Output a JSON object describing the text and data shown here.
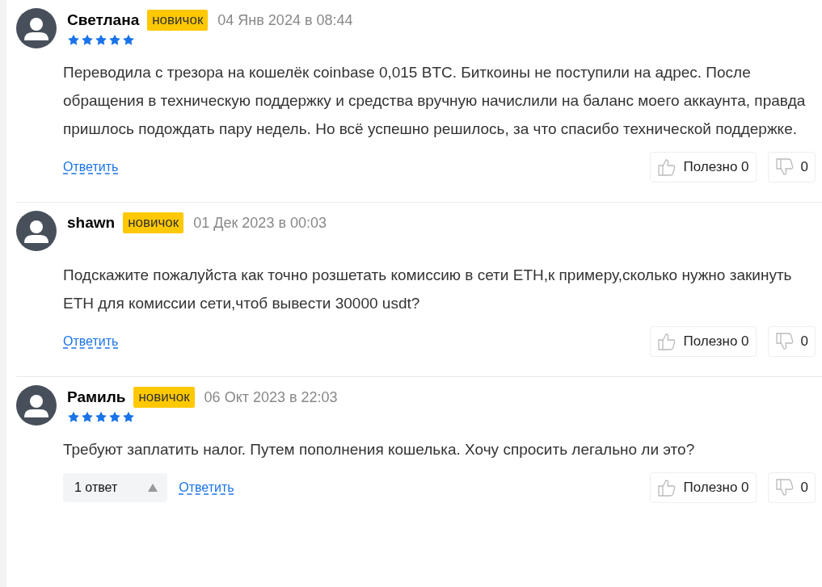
{
  "comments": [
    {
      "author": "Светлана",
      "badge": "новичок",
      "date": "04 Янв 2024 в 08:44",
      "stars": 5,
      "text": "Переводила с трезора на кошелёк coinbase 0,015 BTC. Биткоины не поступили на адрес. После обращения в техническую поддержку и средства вручную начислили на баланс моего аккаунта, правда пришлось подождать пару недель. Но всё успешно решилось, за что спасибо технической поддержке.",
      "reply": "Ответить",
      "useful": "Полезно 0",
      "dislikes": "0"
    },
    {
      "author": "shawn",
      "badge": "новичок",
      "date": "01 Дек 2023 в 00:03",
      "text": "Подскажите пожалуйста как точно розшетать комиссию в сети ETH,к примеру,сколько нужно закинуть ETH для комиссии сети,чтоб вывести 30000 usdt?",
      "reply": "Ответить",
      "useful": "Полезно 0",
      "dislikes": "0"
    },
    {
      "author": "Рамиль",
      "badge": "новичок",
      "date": "06 Окт 2023 в 22:03",
      "stars": 5,
      "text": "Требуют заплатить налог. Путем пополнения кошелька. Хочу спросить легально ли это?",
      "replies": {
        "label": "1 ответ",
        "expanded": true
      },
      "reply": "Ответить",
      "useful": "Полезно 0",
      "dislikes": "0"
    }
  ]
}
